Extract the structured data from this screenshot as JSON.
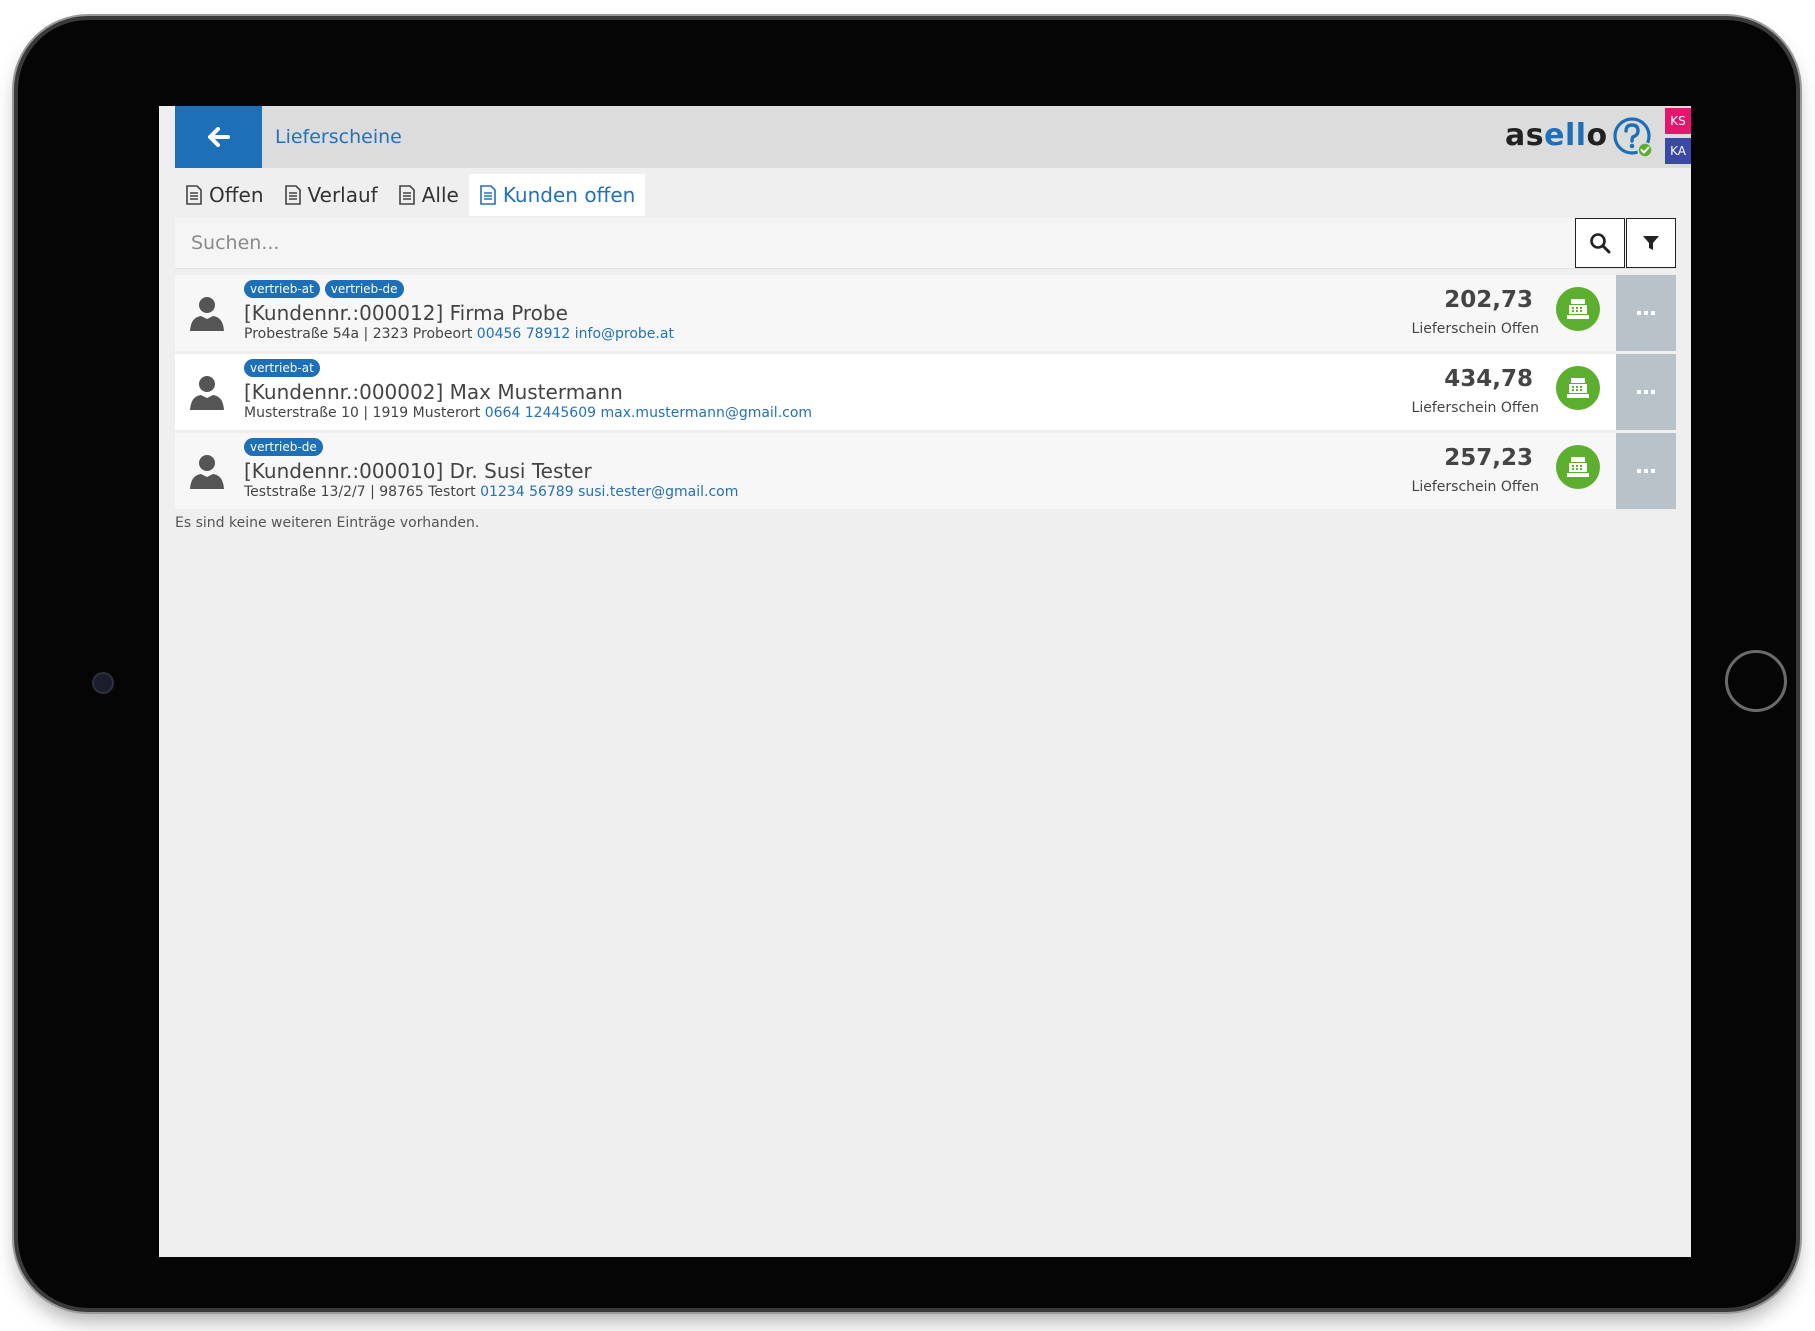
{
  "header": {
    "title": "Lieferscheine",
    "logo_prefix": "as",
    "logo_highlight": "ell",
    "logo_suffix": "o",
    "badges": [
      "KS",
      "KA"
    ]
  },
  "tabs": [
    {
      "label": "Offen",
      "active": false
    },
    {
      "label": "Verlauf",
      "active": false
    },
    {
      "label": "Alle",
      "active": false
    },
    {
      "label": "Kunden offen",
      "active": true
    }
  ],
  "search": {
    "placeholder": "Suchen...",
    "value": ""
  },
  "customers": [
    {
      "tags": [
        "vertrieb-at",
        "vertrieb-de"
      ],
      "name": "[Kundennr.:000012] Firma Probe",
      "address": "Probestraße 54a | 2323 Probeort",
      "phone": "00456 78912",
      "email": "info@probe.at",
      "amount": "202,73",
      "status": "Lieferschein Offen"
    },
    {
      "tags": [
        "vertrieb-at"
      ],
      "name": "[Kundennr.:000002] Max Mustermann",
      "address": "Musterstraße 10 | 1919 Musterort",
      "phone": "0664 12445609",
      "email": "max.mustermann@gmail.com",
      "amount": "434,78",
      "status": "Lieferschein Offen"
    },
    {
      "tags": [
        "vertrieb-de"
      ],
      "name": "[Kundennr.:000010] Dr. Susi Tester",
      "address": "Teststraße 13/2/7 | 98765 Testort",
      "phone": "01234 56789",
      "email": "susi.tester@gmail.com",
      "amount": "257,23",
      "status": "Lieferschein Offen"
    }
  ],
  "footer_note": "Es sind keine weiteren Einträge vorhanden.",
  "colors": {
    "primary": "#1d6fb8",
    "link": "#2371b8",
    "register_green": "#5cae2e",
    "more_gray": "#b9c1c9",
    "badge_ks": "#e4166e",
    "badge_ka": "#3b49a6"
  },
  "icons": {
    "back": "arrow-left-icon",
    "help": "help-question-icon",
    "tab": "document-icon",
    "search": "search-icon",
    "filter": "filter-icon",
    "avatar": "user-icon",
    "register": "cash-register-icon",
    "more": "ellipsis-icon"
  }
}
